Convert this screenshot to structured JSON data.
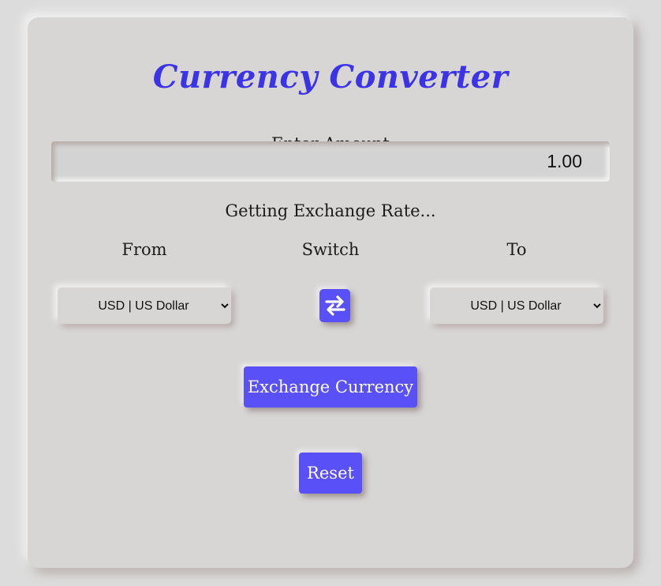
{
  "app": {
    "title": "Currency Converter"
  },
  "amount": {
    "label": "Enter Amount",
    "value": "1.00"
  },
  "status": "Getting Exchange Rate...",
  "from": {
    "label": "From",
    "selected": "USD | US Dollar"
  },
  "switch": {
    "label": "Switch",
    "icon": "swap-arrows-icon"
  },
  "to": {
    "label": "To",
    "selected": "USD | US Dollar"
  },
  "buttons": {
    "exchange": "Exchange Currency",
    "reset": "Reset"
  },
  "colors": {
    "accent": "#5a50f7",
    "title": "#3c32e6",
    "background": "#d8d6d5"
  }
}
